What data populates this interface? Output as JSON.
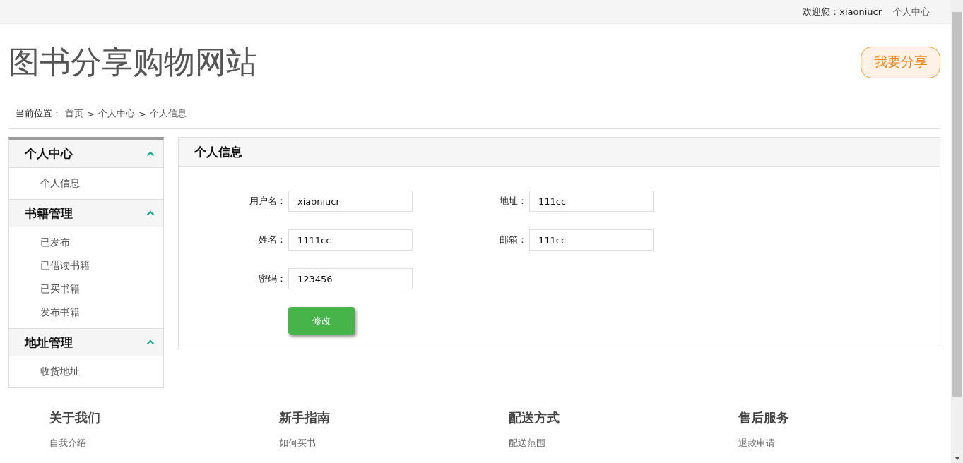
{
  "top_bar": {
    "welcome": "欢迎您：xiaoniucr",
    "user_center_link": "个人中心"
  },
  "header": {
    "site_title": "图书分享购物网站",
    "share_button": "我要分享"
  },
  "breadcrumb": {
    "label": "当前位置：",
    "items": [
      "首页",
      "个人中心",
      "个人信息"
    ],
    "separator": ">"
  },
  "sidebar": {
    "groups": [
      {
        "title": "个人中心",
        "expanded": true,
        "items": [
          "个人信息"
        ]
      },
      {
        "title": "书籍管理",
        "expanded": true,
        "items": [
          "已发布",
          "已借读书籍",
          "已买书籍",
          "发布书籍"
        ]
      },
      {
        "title": "地址管理",
        "expanded": true,
        "items": [
          "收货地址"
        ]
      }
    ]
  },
  "panel": {
    "title": "个人信息",
    "left_fields": [
      {
        "label": "用户名：",
        "value": "xiaoniucr"
      },
      {
        "label": "姓名：",
        "value": "1111cc"
      },
      {
        "label": "密码：",
        "value": "123456"
      }
    ],
    "right_fields": [
      {
        "label": "地址：",
        "value": "111cc"
      },
      {
        "label": "邮箱：",
        "value": "111cc"
      }
    ],
    "submit_button": "修改"
  },
  "footer": {
    "columns": [
      {
        "title": "关于我们",
        "links": [
          "自我介绍"
        ]
      },
      {
        "title": "新手指南",
        "links": [
          "如何买书"
        ]
      },
      {
        "title": "配送方式",
        "links": [
          "配送范围"
        ]
      },
      {
        "title": "售后服务",
        "links": [
          "退款申请"
        ]
      }
    ]
  }
}
